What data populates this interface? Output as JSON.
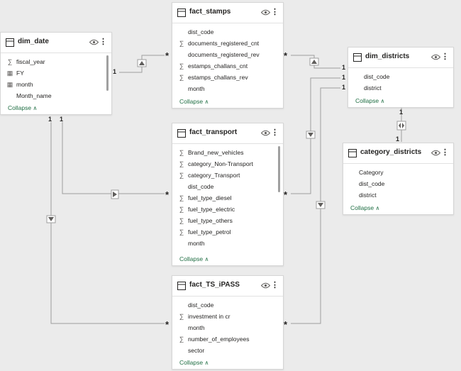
{
  "tables": {
    "dim_date": {
      "title": "dim_date",
      "fields": [
        {
          "name": "fiscal_year",
          "type": "sigma-icon"
        },
        {
          "name": "FY",
          "type": "calendar-icon"
        },
        {
          "name": "month",
          "type": "calendar-icon"
        },
        {
          "name": "Month_name",
          "type": "none"
        }
      ],
      "collapse": "Collapse"
    },
    "fact_stamps": {
      "title": "fact_stamps",
      "fields": [
        {
          "name": "dist_code",
          "type": "none"
        },
        {
          "name": "documents_registered_cnt",
          "type": "sigma-icon"
        },
        {
          "name": "documents_registered_rev",
          "type": "none"
        },
        {
          "name": "estamps_challans_cnt",
          "type": "sigma-icon"
        },
        {
          "name": "estamps_challans_rev",
          "type": "sigma-icon"
        },
        {
          "name": "month",
          "type": "none"
        }
      ],
      "collapse": "Collapse"
    },
    "dim_districts": {
      "title": "dim_districts",
      "fields": [
        {
          "name": "dist_code",
          "type": "none"
        },
        {
          "name": "district",
          "type": "none"
        }
      ],
      "collapse": "Collapse"
    },
    "fact_transport": {
      "title": "fact_transport",
      "fields": [
        {
          "name": "Brand_new_vehicles",
          "type": "sigma-icon"
        },
        {
          "name": "category_Non-Transport",
          "type": "sigma-icon"
        },
        {
          "name": "category_Transport",
          "type": "sigma-icon"
        },
        {
          "name": "dist_code",
          "type": "none"
        },
        {
          "name": "fuel_type_diesel",
          "type": "sigma-icon"
        },
        {
          "name": "fuel_type_electric",
          "type": "sigma-icon"
        },
        {
          "name": "fuel_type_others",
          "type": "sigma-icon"
        },
        {
          "name": "fuel_type_petrol",
          "type": "sigma-icon"
        },
        {
          "name": "month",
          "type": "none"
        }
      ],
      "collapse": "Collapse"
    },
    "category_districts": {
      "title": "category_districts",
      "fields": [
        {
          "name": "Category",
          "type": "none"
        },
        {
          "name": "dist_code",
          "type": "none"
        },
        {
          "name": "district",
          "type": "none"
        }
      ],
      "collapse": "Collapse"
    },
    "fact_TS_iPASS": {
      "title": "fact_TS_iPASS",
      "fields": [
        {
          "name": "dist_code",
          "type": "none"
        },
        {
          "name": "investment in cr",
          "type": "sigma-icon"
        },
        {
          "name": "month",
          "type": "none"
        },
        {
          "name": "number_of_employees",
          "type": "sigma-icon"
        },
        {
          "name": "sector",
          "type": "none"
        }
      ],
      "collapse": "Collapse"
    }
  },
  "relationships": {
    "one": "1",
    "many": "*"
  },
  "colors": {
    "line": "#9e9e9e",
    "accent": "#1f6e43"
  }
}
